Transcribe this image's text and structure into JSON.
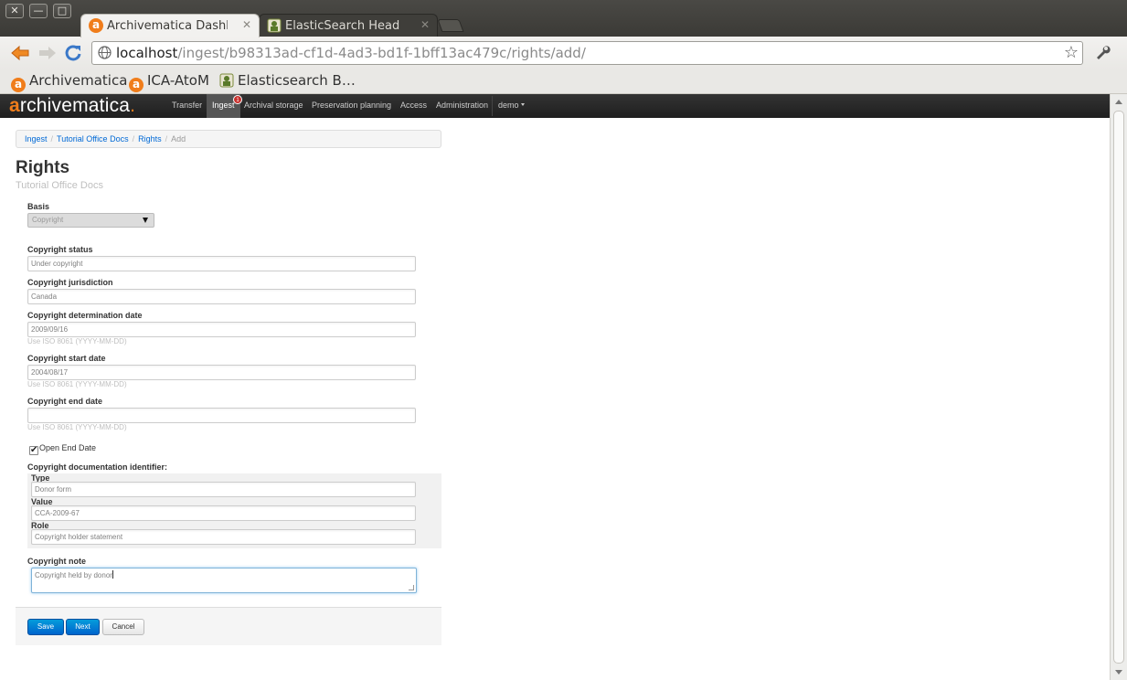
{
  "browser": {
    "tabs": [
      {
        "title": "Archivematica Dashboard",
        "active": true
      },
      {
        "title": "ElasticSearch Head",
        "active": false
      }
    ],
    "url_host": "localhost",
    "url_path": "/ingest/b98313ad-cf1d-4ad3-bd1f-1bff13ac479c/rights/add/",
    "bookmarks": [
      "Archivematica",
      "ICA-AtoM",
      "Elasticsearch B…"
    ]
  },
  "navbar": {
    "brand_a": "a",
    "brand_rest": "rchivematica",
    "brand_dot": ".",
    "items": [
      "Transfer",
      "Ingest",
      "Archival storage",
      "Preservation planning",
      "Access",
      "Administration"
    ],
    "ingest_badge": "1",
    "user": "demo"
  },
  "breadcrumb": {
    "items": [
      "Ingest",
      "Tutorial Office Docs",
      "Rights"
    ],
    "current": "Add",
    "separator": "/"
  },
  "page": {
    "title": "Rights",
    "subtitle": "Tutorial Office Docs"
  },
  "form": {
    "basis": {
      "label": "Basis",
      "value": "Copyright"
    },
    "copyright_status": {
      "label": "Copyright status",
      "value": "Under copyright"
    },
    "copyright_jurisdiction": {
      "label": "Copyright jurisdiction",
      "value": "Canada"
    },
    "copyright_determination_date": {
      "label": "Copyright determination date",
      "value": "2009/09/16",
      "hint": "Use ISO 8061 (YYYY-MM-DD)"
    },
    "copyright_start_date": {
      "label": "Copyright start date",
      "value": "2004/08/17",
      "hint": "Use ISO 8061 (YYYY-MM-DD)"
    },
    "copyright_end_date": {
      "label": "Copyright end date",
      "value": "",
      "hint": "Use ISO 8061 (YYYY-MM-DD)"
    },
    "open_end_date": {
      "label": "Open End Date",
      "checked": true
    },
    "doc_identifier": {
      "label": "Copyright documentation identifier:",
      "type_label": "Type",
      "type_value": "Donor form",
      "value_label": "Value",
      "value_value": "CCA-2009-67",
      "role_label": "Role",
      "role_value": "Copyright holder statement"
    },
    "copyright_note": {
      "label": "Copyright note",
      "value": "Copyright held by donor"
    }
  },
  "actions": {
    "save": "Save",
    "next": "Next",
    "cancel": "Cancel"
  },
  "colors": {
    "accent": "#f07d1b",
    "primary_button": "#0064cd",
    "link": "#0069d6"
  }
}
